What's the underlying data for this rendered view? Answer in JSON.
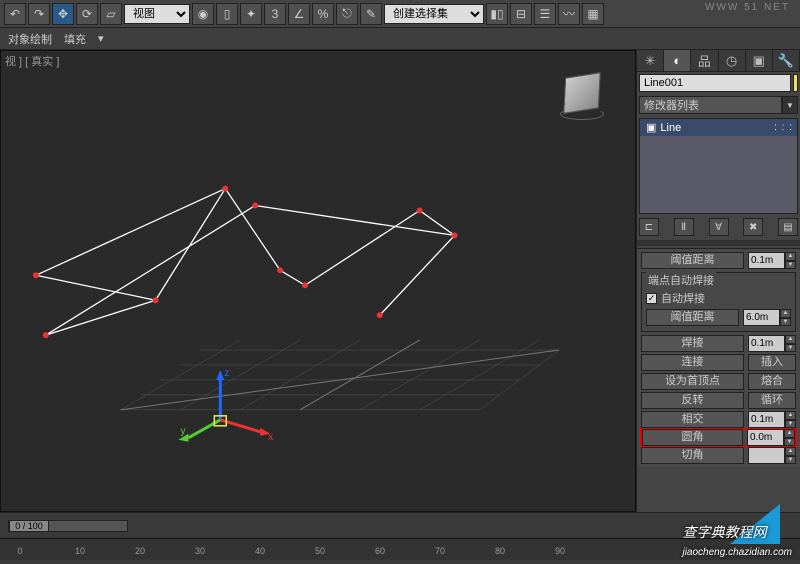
{
  "toolbar": {
    "view_label": "视图",
    "selection_set": "创建选择集"
  },
  "sub_toolbar": {
    "object_draw": "对象绘制",
    "fill": "填充"
  },
  "viewport": {
    "label": "视 ] [ 真实 ]"
  },
  "panel": {
    "object_name": "Line001",
    "modifier_list_label": "修改器列表",
    "stack_item": "Line"
  },
  "rollouts": {
    "threshold_dist": {
      "label": "阈值距离",
      "value": "0.1m"
    },
    "auto_weld_group": "端点自动焊接",
    "auto_weld_chk": "自动焊接",
    "threshold_dist2": {
      "label": "阈值距离",
      "value": "6.0m"
    },
    "weld": {
      "label": "焊接",
      "value": "0.1m"
    },
    "connect": {
      "label": "连接",
      "btn": "插入"
    },
    "make_first": {
      "label": "设为首顶点",
      "btn": "熔合"
    },
    "reverse": {
      "label": "反转",
      "btn": "循环"
    },
    "crosssect": {
      "label": "相交",
      "value": "0.1m"
    },
    "fillet": {
      "label": "圆角",
      "value": "0.0m"
    },
    "chamfer": {
      "label": "切角",
      "value": ""
    }
  },
  "timeline": {
    "frame": "0 / 100"
  },
  "watermarks": {
    "top_url": "WWW   51   NET",
    "bottom": "查字典教程网",
    "bottom_url": "jiaocheng.chazidian.com"
  }
}
